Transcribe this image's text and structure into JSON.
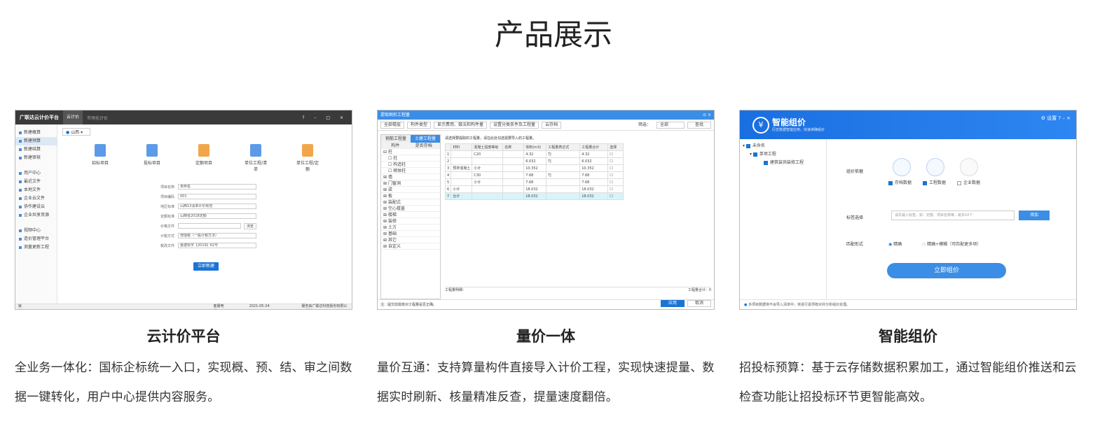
{
  "page_title": "产品展示",
  "cards": [
    {
      "title": "云计价平台",
      "desc": "全业务一体化：国标企标统一入口，实现概、预、结、审之间数据一键转化，用户中心提供内容服务。"
    },
    {
      "title": "量价一体",
      "desc": "量价互通：支持算量构件直接导入计价工程，实现快速提量、数据实时刷新、核量精准反查，提量速度翻倍。"
    },
    {
      "title": "智能组价",
      "desc": "招投标预算：基于云存储数据积累加工，通过智能组价推送和云检查功能让招投标环节更智能高效。"
    }
  ],
  "shot1": {
    "app_name": "广联达云计价平台",
    "tab_active": "云计价",
    "tab_other": "市场化计价",
    "window_controls": "? – □ ×",
    "side": [
      "新建概算",
      "新建预算",
      "新建结算",
      "新建审核",
      "用户中心",
      "最近文件",
      "本地文件",
      "企业云文件",
      "协作建设云",
      "企业共享资源",
      "视频中心",
      "造价管理平台",
      "测量更新工程"
    ],
    "city": "山西",
    "icons": [
      "招标项目",
      "投标项目",
      "定额项目",
      "单位工程/清单",
      "单位工程/定额"
    ],
    "icon_colors": [
      "#5b9be8",
      "#5b9be8",
      "#f2a64b",
      "#5b9be8",
      "#f2a64b"
    ],
    "form": [
      {
        "l": "项目名称",
        "v": "未命名"
      },
      {
        "l": "项目编码",
        "v": "001"
      },
      {
        "l": "地区标准",
        "v": "山西13清单计价规范"
      },
      {
        "l": "定额标准",
        "v": "山西省2018定额"
      },
      {
        "l": "价格文件",
        "v": ""
      },
      {
        "l": "计税方式",
        "v": "增值税（一般计税方法）"
      },
      {
        "l": "税改文件",
        "v": "晋建标字【2019】62号"
      }
    ],
    "browse": "浏览",
    "create": "立即新建",
    "status": [
      "就绪",
      "客服电话：",
      "2021-05-24 15:48:42",
      "服务由广联达科技股份有限公司提供"
    ]
  },
  "shot2": {
    "title": "提取图形工程量",
    "close": "⊙ ×",
    "toolbar": [
      "全部楼层",
      "构件类型",
      "显示费用、做法和构件量",
      "设置分类条件及工程量",
      "云存档"
    ],
    "filter_label": "筛选：",
    "filter_value": "全部",
    "search": "查找",
    "tabs": [
      "钢筋工程量",
      "土建工程量"
    ],
    "left_head": [
      "构件",
      "是否存档"
    ],
    "left_rows": [
      "柱",
      "柱",
      "构造柱",
      "砌体柱",
      "墙",
      "门窗洞",
      "梁",
      "板",
      "装配式",
      "空心楼盖",
      "楼梯",
      "装修",
      "土方",
      "基础",
      "其它",
      "自定义"
    ],
    "note": "请选择要提取的工程量，请在此处勾选需要导入的工程量。",
    "grid_head": [
      "",
      "材料",
      "混凝土强度等级",
      "名称",
      "体积(m3)",
      "工程量表达式",
      "工程量合计",
      "选择"
    ],
    "grid": [
      [
        "1",
        "",
        "C20",
        "",
        "4.32",
        "TJ",
        "4.32",
        ""
      ],
      [
        "2",
        "",
        "",
        "",
        "6.032",
        "TJ",
        "6.032",
        ""
      ],
      [
        "3",
        "预拌混凝土",
        "小计",
        "",
        "10.352",
        "",
        "10.352",
        ""
      ],
      [
        "4",
        "",
        "C30",
        "",
        "7.68",
        "TJ",
        "7.68",
        ""
      ],
      [
        "5",
        "",
        "小计",
        "",
        "7.68",
        "",
        "7.68",
        ""
      ],
      [
        "6",
        "小计",
        "",
        "",
        "18.032",
        "",
        "18.032",
        ""
      ],
      [
        "7",
        "合计",
        "",
        "",
        "18.032",
        "",
        "18.032",
        ""
      ]
    ],
    "foot_left": "工程量明细：",
    "foot_right": "工程量合计：0",
    "bottom_note": "注：提交前需核对工程量是否正确。",
    "ok": "应用",
    "cancel": "取消"
  },
  "shot3": {
    "app": "智能组价",
    "sub": "历史数据智能应用，快速准确组价",
    "header_right": "⚙ 设置  ?  –  ×",
    "tree": [
      "未命名",
      "单项工程",
      "建筑装饰装修工程"
    ],
    "label_source": "组价依据",
    "label_match": "标签选择",
    "label_mode": "匹配形式",
    "sources": [
      "存档数据",
      "工程数据",
      "企业数据"
    ],
    "input_placeholder": "请先输入标签，如：定额、项目名称等，最多10个",
    "add": "添加",
    "modes": [
      "精确",
      "精确+模糊（可匹配更多项）"
    ],
    "go": "立即组价",
    "bottom": "多项目数据将不会导入清单中，将进行逐项核对并分析组价处理。"
  }
}
